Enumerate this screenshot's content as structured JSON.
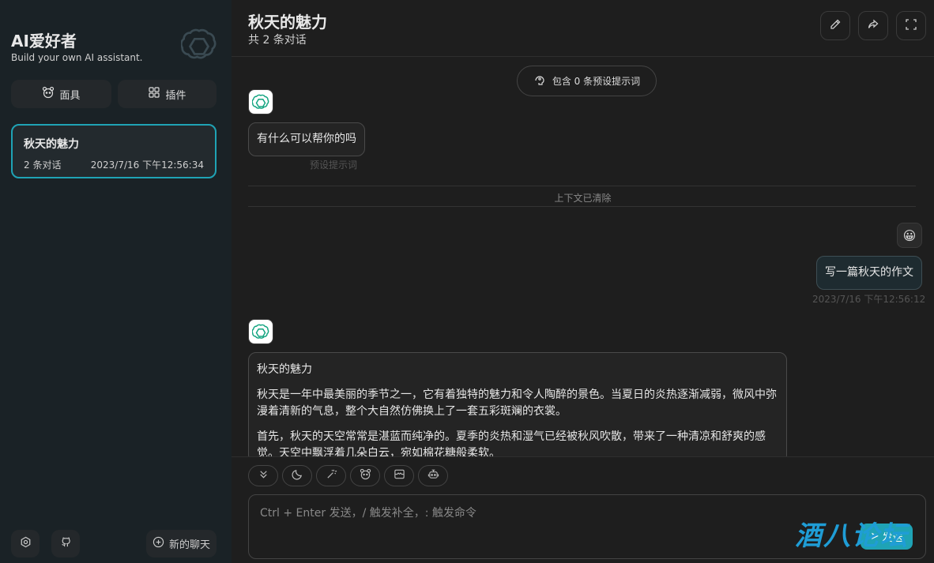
{
  "sidebar": {
    "app_title": "AI爱好者",
    "app_subtitle": "Build your own AI assistant.",
    "mask_label": "面具",
    "plugin_label": "插件",
    "chat": {
      "title": "秋天的魅力",
      "count": "2 条对话",
      "time": "2023/7/16 下午12:56:34"
    },
    "new_chat_label": "新的聊天"
  },
  "header": {
    "title": "秋天的魅力",
    "subtitle": "共 2 条对话"
  },
  "context": {
    "pill_label": "包含 0 条预设提示词",
    "preset_message": "有什么可以帮你的吗",
    "preset_meta": "预设提示词",
    "cleared_label": "上下文已清除"
  },
  "messages": {
    "user_text": "写一篇秋天的作文",
    "user_time": "2023/7/16 下午12:56:12",
    "bot_title": "秋天的魅力",
    "bot_p1": "秋天是一年中最美丽的季节之一，它有着独特的魅力和令人陶醉的景色。当夏日的炎热逐渐减弱，微风中弥漫着清新的气息，整个大自然仿佛换上了一套五彩斑斓的衣裳。",
    "bot_p2": "首先，秋天的天空常常是湛蓝而纯净的。夏季的炎热和湿气已经被秋风吹散，带来了一种清凉和舒爽的感觉。天空中飘浮着几朵白云，宛如棉花糖般柔软。"
  },
  "composer": {
    "placeholder": "Ctrl + Enter 发送，/ 触发补全，: 触发命令",
    "send_label": "发送"
  },
  "watermark": "酒八论坛",
  "colors": {
    "accent": "#1fa3b5",
    "sidebar_bg": "#1a2226",
    "main_bg": "#1e1e1e"
  }
}
